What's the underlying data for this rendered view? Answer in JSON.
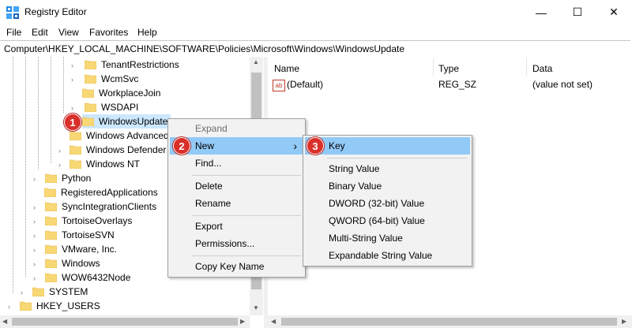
{
  "window": {
    "title": "Registry Editor",
    "minimize_glyph": "—",
    "maximize_glyph": "☐",
    "close_glyph": "✕"
  },
  "menu": [
    "File",
    "Edit",
    "View",
    "Favorites",
    "Help"
  ],
  "address": "Computer\\HKEY_LOCAL_MACHINE\\SOFTWARE\\Policies\\Microsoft\\Windows\\WindowsUpdate",
  "tree": {
    "items": [
      {
        "label": "TenantRestrictions"
      },
      {
        "label": "WcmSvc"
      },
      {
        "label": "WorkplaceJoin"
      },
      {
        "label": "WSDAPI"
      },
      {
        "label": "WindowsUpdate"
      },
      {
        "label": "Windows Advanced"
      },
      {
        "label": "Windows Defender"
      },
      {
        "label": "Windows NT"
      },
      {
        "label": "Python"
      },
      {
        "label": "RegisteredApplications"
      },
      {
        "label": "SyncIntegrationClients"
      },
      {
        "label": "TortoiseOverlays"
      },
      {
        "label": "TortoiseSVN"
      },
      {
        "label": "VMware, Inc."
      },
      {
        "label": "Windows"
      },
      {
        "label": "WOW6432Node"
      },
      {
        "label": "SYSTEM"
      },
      {
        "label": "HKEY_USERS"
      }
    ]
  },
  "values_pane": {
    "columns": [
      "Name",
      "Type",
      "Data"
    ],
    "rows": [
      {
        "icon": "ab",
        "name": "(Default)",
        "type": "REG_SZ",
        "data": "(value not set)"
      }
    ]
  },
  "context_menu": {
    "items": [
      "Expand",
      "New",
      "Find...",
      "Delete",
      "Rename",
      "Export",
      "Permissions...",
      "Copy Key Name"
    ],
    "submenu_arrow": "›"
  },
  "submenu": {
    "items": [
      "Key",
      "String Value",
      "Binary Value",
      "DWORD (32-bit) Value",
      "QWORD (64-bit) Value",
      "Multi-String Value",
      "Expandable String Value"
    ]
  },
  "badges": [
    "1",
    "2",
    "3"
  ],
  "colors": {
    "folder": "#f8d775",
    "highlight": "#91c9f7",
    "badge": "#d9302a"
  }
}
